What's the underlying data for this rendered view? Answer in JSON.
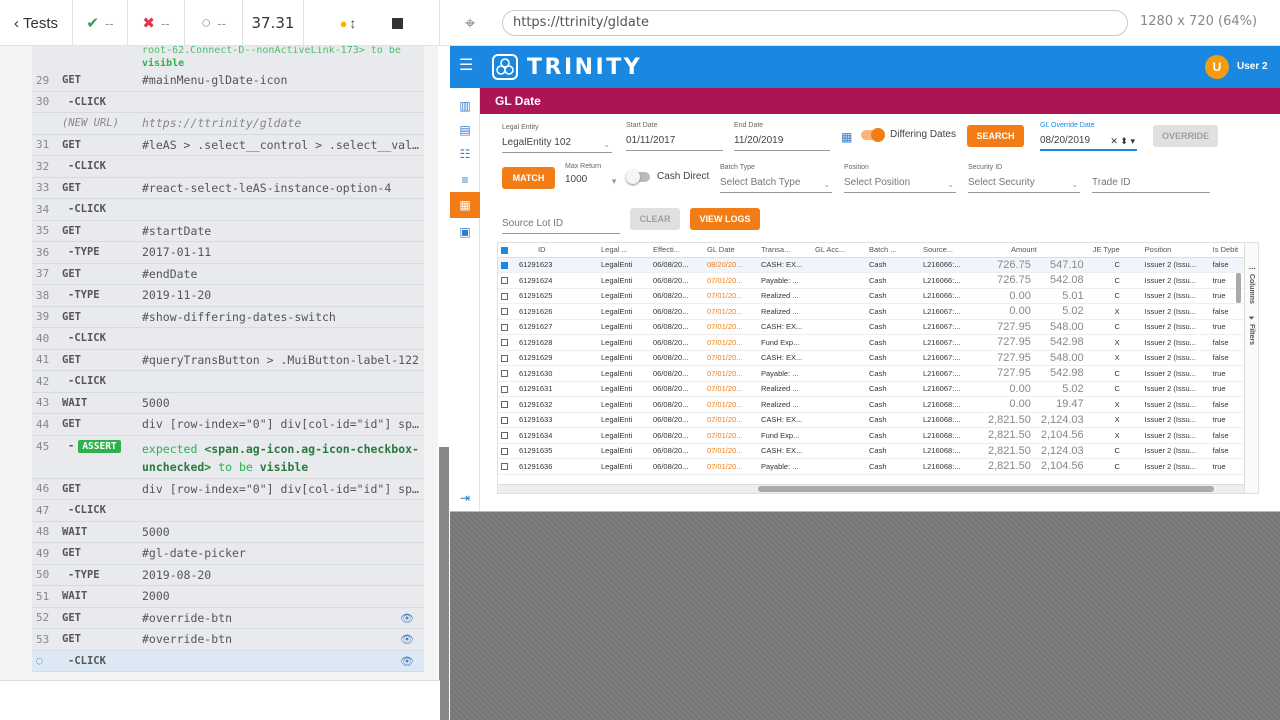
{
  "topbar": {
    "tests_label": "Tests",
    "passed_count": "--",
    "failed_count": "--",
    "pending_count": "--",
    "duration": "37.31",
    "url": "https://ttrinity/gldate",
    "viewport": "1280 x 720",
    "scale": "(64%)"
  },
  "command_log": {
    "top_fragment": "root-62.Connect-D--nonActiveLink-173> to be",
    "top_fragment_2": "visible",
    "rows": [
      {
        "num": "29",
        "cmd": "GET",
        "msg": "#mainMenu-glDate-icon"
      },
      {
        "num": "30",
        "cmd": "-CLICK",
        "msg": ""
      },
      {
        "num": "",
        "cmd": "(NEW URL)",
        "msg": "https://ttrinity/gldate"
      },
      {
        "num": "31",
        "cmd": "GET",
        "msg": "#leAS > .select__control > .select__value-container"
      },
      {
        "num": "32",
        "cmd": "-CLICK",
        "msg": ""
      },
      {
        "num": "33",
        "cmd": "GET",
        "msg": "#react-select-leAS-instance-option-4"
      },
      {
        "num": "34",
        "cmd": "-CLICK",
        "msg": ""
      },
      {
        "num": "35",
        "cmd": "GET",
        "msg": "#startDate"
      },
      {
        "num": "36",
        "cmd": "-TYPE",
        "msg": "2017-01-11"
      },
      {
        "num": "37",
        "cmd": "GET",
        "msg": "#endDate"
      },
      {
        "num": "38",
        "cmd": "-TYPE",
        "msg": "2019-11-20"
      },
      {
        "num": "39",
        "cmd": "GET",
        "msg": "#show-differing-dates-switch"
      },
      {
        "num": "40",
        "cmd": "-CLICK",
        "msg": ""
      },
      {
        "num": "41",
        "cmd": "GET",
        "msg": "#queryTransButton > .MuiButton-label-122"
      },
      {
        "num": "42",
        "cmd": "-CLICK",
        "msg": ""
      },
      {
        "num": "43",
        "cmd": "WAIT",
        "msg": "5000"
      },
      {
        "num": "44",
        "cmd": "GET",
        "msg": "div [row-index=\"0\"] div[col-id=\"id\"] span.ag-icon"
      }
    ],
    "assert_row": {
      "num": "45",
      "badge": "ASSERT",
      "expected": "expected",
      "target": "<span.ag-icon.ag-icon-checkbox-unchecked>",
      "to_be": "to be",
      "visible": "visible"
    },
    "rows2": [
      {
        "num": "46",
        "cmd": "GET",
        "msg": "div [row-index=\"0\"] div[col-id=\"id\"] span.ag-icon"
      },
      {
        "num": "47",
        "cmd": "-CLICK",
        "msg": ""
      },
      {
        "num": "48",
        "cmd": "WAIT",
        "msg": "5000"
      },
      {
        "num": "49",
        "cmd": "GET",
        "msg": "#gl-date-picker"
      },
      {
        "num": "50",
        "cmd": "-TYPE",
        "msg": "2019-08-20"
      },
      {
        "num": "51",
        "cmd": "WAIT",
        "msg": "2000"
      },
      {
        "num": "52",
        "cmd": "GET",
        "msg": "#override-btn"
      },
      {
        "num": "53",
        "cmd": "GET",
        "msg": "#override-btn"
      },
      {
        "num": "",
        "cmd": "-CLICK",
        "msg": ""
      }
    ]
  },
  "app": {
    "brand": "TRINITY",
    "avatar_initial": "U",
    "username": "User 2",
    "page_title": "GL Date",
    "filters": {
      "legal_entity_label": "Legal Entity",
      "legal_entity_value": "LegalEntity 102",
      "start_date_label": "Start Date",
      "start_date_value": "01/11/2017",
      "end_date_label": "End Date",
      "end_date_value": "11/20/2019",
      "differing_dates_label": "Differing Dates",
      "search_btn": "SEARCH",
      "gl_override_label": "GL Override Date",
      "gl_override_value": "08/20/2019",
      "override_btn": "OVERRIDE",
      "match_btn": "MATCH",
      "max_return_label": "Max Return",
      "max_return_value": "1000",
      "cash_direct_label": "Cash Direct",
      "batch_type_label": "Batch Type",
      "batch_type_ph": "Select Batch Type",
      "position_label": "Position",
      "position_ph": "Select Position",
      "security_label": "Security ID",
      "security_ph": "Select Security",
      "trade_id_ph": "Trade ID",
      "source_lot_ph": "Source Lot ID",
      "clear_btn": "CLEAR",
      "view_logs_btn": "VIEW LOGS"
    },
    "grid": {
      "columns": [
        "ID",
        "Legal ...",
        "Effecti...",
        "GL Date",
        "Transa...",
        "GL Acc...",
        "Batch ...",
        "Source...",
        "Amount",
        "",
        "JE Type",
        "Position",
        "Is Debit"
      ],
      "side_columns": "Columns",
      "side_filters": "Filters",
      "rows": [
        [
          "61291623",
          "LegalEnti",
          "06/08/20...",
          "08/20/20...",
          "CASH: EX...",
          "",
          "Cash",
          "L216066:...",
          "726.75",
          "547.10",
          "C",
          "Issuer 2 (Issu...",
          "false"
        ],
        [
          "61291624",
          "LegalEnti",
          "06/08/20...",
          "07/01/20...",
          "Payable: ...",
          "",
          "Cash",
          "L216066:...",
          "726.75",
          "542.08",
          "C",
          "Issuer 2 (Issu...",
          "true"
        ],
        [
          "61291625",
          "LegalEnti",
          "06/08/20...",
          "07/01/20...",
          "Realized ...",
          "",
          "Cash",
          "L216066:...",
          "0.00",
          "5.01",
          "C",
          "Issuer 2 (Issu...",
          "true"
        ],
        [
          "61291626",
          "LegalEnti",
          "06/08/20...",
          "07/01/20...",
          "Realized ...",
          "",
          "Cash",
          "L216067:...",
          "0.00",
          "5.02",
          "X",
          "Issuer 2 (Issu...",
          "false"
        ],
        [
          "61291627",
          "LegalEnti",
          "06/08/20...",
          "07/01/20...",
          "CASH: EX...",
          "",
          "Cash",
          "L216067:...",
          "727.95",
          "548.00",
          "C",
          "Issuer 2 (Issu...",
          "true"
        ],
        [
          "61291628",
          "LegalEnti",
          "06/08/20...",
          "07/01/20...",
          "Fund Exp...",
          "",
          "Cash",
          "L216067:...",
          "727.95",
          "542.98",
          "X",
          "Issuer 2 (Issu...",
          "false"
        ],
        [
          "61291629",
          "LegalEnti",
          "06/08/20...",
          "07/01/20...",
          "CASH: EX...",
          "",
          "Cash",
          "L216067:...",
          "727.95",
          "548.00",
          "X",
          "Issuer 2 (Issu...",
          "false"
        ],
        [
          "61291630",
          "LegalEnti",
          "06/08/20...",
          "07/01/20...",
          "Payable: ...",
          "",
          "Cash",
          "L216067:...",
          "727.95",
          "542.98",
          "C",
          "Issuer 2 (Issu...",
          "true"
        ],
        [
          "61291631",
          "LegalEnti",
          "06/08/20...",
          "07/01/20...",
          "Realized ...",
          "",
          "Cash",
          "L216067:...",
          "0.00",
          "5.02",
          "C",
          "Issuer 2 (Issu...",
          "true"
        ],
        [
          "61291632",
          "LegalEnti",
          "06/08/20...",
          "07/01/20...",
          "Realized ...",
          "",
          "Cash",
          "L216068:...",
          "0.00",
          "19.47",
          "X",
          "Issuer 2 (Issu...",
          "false"
        ],
        [
          "61291633",
          "LegalEnti",
          "06/08/20...",
          "07/01/20...",
          "CASH: EX...",
          "",
          "Cash",
          "L216068:...",
          "2,821.50",
          "2,124.03",
          "X",
          "Issuer 2 (Issu...",
          "true"
        ],
        [
          "61291634",
          "LegalEnti",
          "06/08/20...",
          "07/01/20...",
          "Fund Exp...",
          "",
          "Cash",
          "L216068:...",
          "2,821.50",
          "2,104.56",
          "X",
          "Issuer 2 (Issu...",
          "false"
        ],
        [
          "61291635",
          "LegalEnti",
          "06/08/20...",
          "07/01/20...",
          "CASH: EX...",
          "",
          "Cash",
          "L216068:...",
          "2,821.50",
          "2,124.03",
          "C",
          "Issuer 2 (Issu...",
          "false"
        ],
        [
          "61291636",
          "LegalEnti",
          "06/08/20...",
          "07/01/20...",
          "Payable: ...",
          "",
          "Cash",
          "L216068:...",
          "2,821.50",
          "2,104.56",
          "C",
          "Issuer 2 (Issu...",
          "true"
        ]
      ]
    }
  },
  "colors": {
    "primary": "#1a88e0",
    "accent": "#f27d16",
    "title_bar": "#ad1456",
    "pass": "#2e9e5b",
    "fail": "#e2354b"
  }
}
